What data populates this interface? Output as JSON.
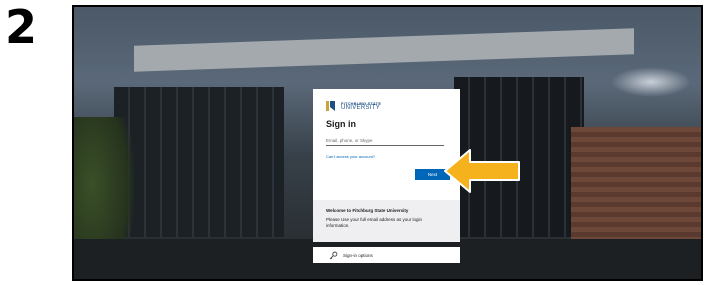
{
  "step": {
    "number": "2"
  },
  "signin": {
    "logo_top": "FITCHBURG STATE",
    "logo_bottom": "UNIVERSITY",
    "title": "Sign in",
    "email_placeholder": "Email, phone, or Skype",
    "email_value": "",
    "cant_access": "Can't access your account?",
    "next_label": "Next"
  },
  "welcome": {
    "title": "Welcome to Fitchburg State University",
    "body": "Please Use your full email address as your login information."
  },
  "options": {
    "label": "Sign-in options",
    "icon": "key-icon"
  },
  "colors": {
    "accent": "#0067b8",
    "arrow": "#f5b21c",
    "brand_blue": "#1f4f86",
    "brand_gold": "#c8a43b"
  }
}
